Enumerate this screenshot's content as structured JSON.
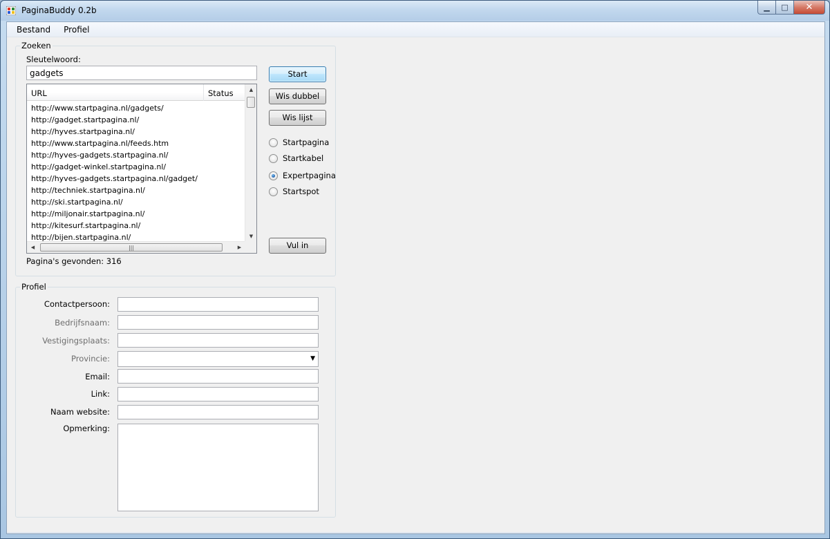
{
  "window": {
    "title": "PaginaBuddy 0.2b"
  },
  "menu": {
    "items": [
      "Bestand",
      "Profiel"
    ]
  },
  "search": {
    "group_title": "Zoeken",
    "keyword_label": "Sleutelwoord:",
    "keyword_value": "gadgets",
    "columns": [
      "URL",
      "Status"
    ],
    "rows": [
      "http://www.startpagina.nl/gadgets/",
      "http://gadget.startpagina.nl/",
      "http://hyves.startpagina.nl/",
      "http://www.startpagina.nl/feeds.htm",
      "http://hyves-gadgets.startpagina.nl/",
      "http://gadget-winkel.startpagina.nl/",
      "http://hyves-gadgets.startpagina.nl/gadget/",
      "http://techniek.startpagina.nl/",
      "http://ski.startpagina.nl/",
      "http://miljonair.startpagina.nl/",
      "http://kitesurf.startpagina.nl/",
      "http://bijen.startpagina.nl/"
    ],
    "found_text": "Pagina's gevonden: 316",
    "buttons": {
      "start": "Start",
      "wis_dubbel": "Wis dubbel",
      "wis_lijst": "Wis lijst",
      "vul_in": "Vul in"
    },
    "radios": [
      {
        "label": "Startpagina",
        "checked": false
      },
      {
        "label": "Startkabel",
        "checked": false
      },
      {
        "label": "Expertpagina",
        "checked": true
      },
      {
        "label": "Startspot",
        "checked": false
      }
    ]
  },
  "profile": {
    "group_title": "Profiel",
    "fields": {
      "contactpersoon": {
        "label": "Contactpersoon:",
        "value": ""
      },
      "bedrijfsnaam": {
        "label": "Bedrijfsnaam:",
        "value": ""
      },
      "vestigingsplaats": {
        "label": "Vestigingsplaats:",
        "value": ""
      },
      "provincie": {
        "label": "Provincie:",
        "value": ""
      },
      "email": {
        "label": "Email:",
        "value": ""
      },
      "link": {
        "label": "Link:",
        "value": ""
      },
      "naam_website": {
        "label": "Naam website:",
        "value": ""
      },
      "opmerking": {
        "label": "Opmerking:",
        "value": ""
      }
    }
  },
  "icons": {
    "app": "app-grid-icon",
    "minimize": "minimize-icon",
    "maximize": "maximize-icon",
    "close": "close-icon"
  },
  "colors": {
    "accent": "#3c7fb1",
    "disabled_label": "#6d6d6d"
  }
}
